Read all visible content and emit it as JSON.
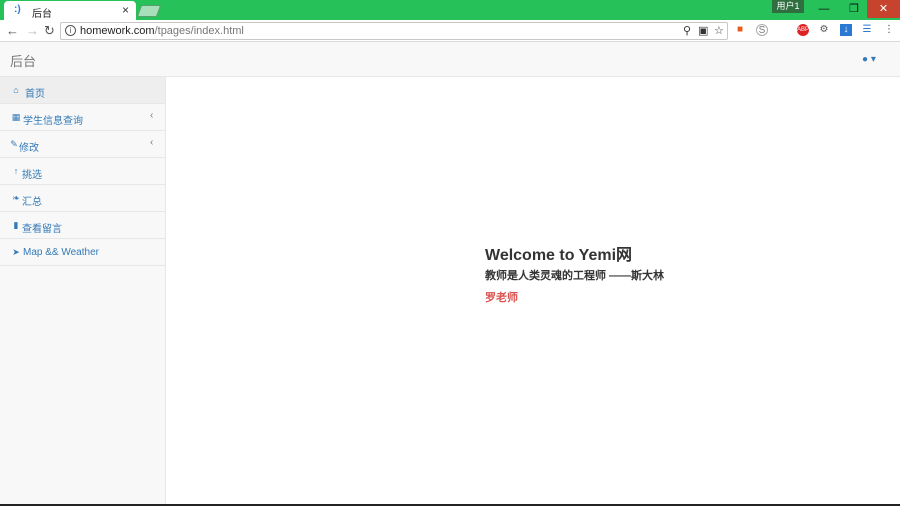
{
  "browser": {
    "tab_title": "后台",
    "tab_close": "×",
    "user_badge": "用户1",
    "url_host": "homework.com",
    "url_path": "/tpages/index.html"
  },
  "navbar": {
    "brand": "后台",
    "user_icon": "user-icon"
  },
  "sidebar": {
    "items": [
      {
        "label": "首页",
        "icon": "home-icon",
        "active": true,
        "has_submenu": false
      },
      {
        "label": "学生信息查询",
        "icon": "table-icon",
        "active": false,
        "has_submenu": true
      },
      {
        "label": "修改",
        "icon": "edit-icon",
        "active": false,
        "has_submenu": true
      },
      {
        "label": "挑选",
        "icon": "pushpin-icon",
        "active": false,
        "has_submenu": false
      },
      {
        "label": "汇总",
        "icon": "leaf-icon",
        "active": false,
        "has_submenu": false
      },
      {
        "label": "查看留言",
        "icon": "book-icon",
        "active": false,
        "has_submenu": false
      },
      {
        "label": "Map && Weather",
        "icon": "location-arrow-icon",
        "active": false,
        "has_submenu": false
      }
    ]
  },
  "main": {
    "welcome": "Welcome to Yemi网",
    "quote": "教师是人类灵魂的工程师 ——斯大林",
    "teacher": "罗老师"
  },
  "colors": {
    "titlebar": "#27c15a",
    "link": "#337ab7",
    "accent_red": "#d9534f"
  }
}
